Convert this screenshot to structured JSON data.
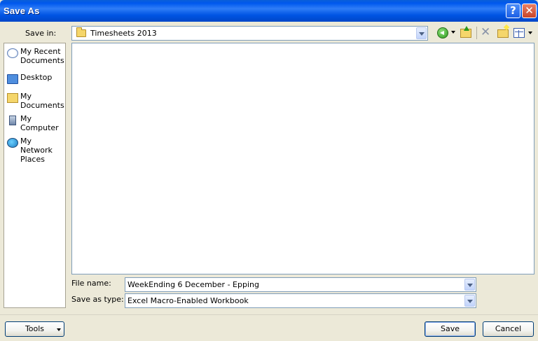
{
  "window": {
    "title": "Save As"
  },
  "titlebar": {
    "help_glyph": "?",
    "close_glyph": "✕"
  },
  "save_in": {
    "label": "Save in:",
    "value": "Timesheets 2013",
    "icon": "folder-icon"
  },
  "toolbar": {
    "icons": [
      "back-icon",
      "up-one-level-icon",
      "delete-icon",
      "create-new-folder-icon",
      "views-icon"
    ],
    "delete_glyph": "✕"
  },
  "places": [
    {
      "label": "My Recent Documents",
      "line1": "My Recent",
      "line2": "Documents",
      "icon": "recent-documents-icon"
    },
    {
      "label": "Desktop",
      "line1": "Desktop",
      "line2": "",
      "icon": "desktop-icon"
    },
    {
      "label": "My Documents",
      "line1": "My",
      "line2": "Documents",
      "icon": "my-documents-icon"
    },
    {
      "label": "My Computer",
      "line1": "My",
      "line2": "Computer",
      "icon": "my-computer-icon"
    },
    {
      "label": "My Network Places",
      "line1": "My Network",
      "line2": "Places",
      "icon": "my-network-places-icon"
    }
  ],
  "file_name": {
    "label": "File name:",
    "value": "WeekEnding 6 December - Epping"
  },
  "save_as_type": {
    "label": "Save as type:",
    "value": "Excel Macro-Enabled Workbook"
  },
  "buttons": {
    "tools": "Tools",
    "save": "Save",
    "cancel": "Cancel"
  }
}
